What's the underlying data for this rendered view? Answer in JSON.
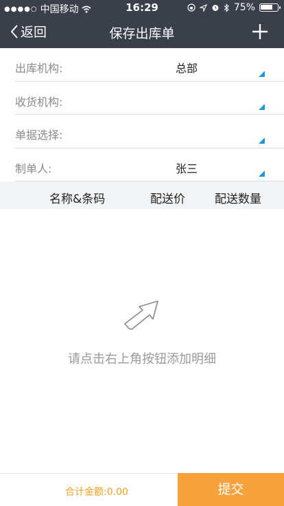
{
  "status_bar": {
    "carrier": "中国移动",
    "time": "16:29",
    "battery": "75%",
    "battery_level": 0.75
  },
  "nav": {
    "back_label": "返回",
    "title": "保存出库单",
    "add_icon": "plus-icon"
  },
  "form": {
    "rows": [
      {
        "label": "出库机构:",
        "value": "总部"
      },
      {
        "label": "收货机构:",
        "value": ""
      },
      {
        "label": "单据选择:",
        "value": ""
      },
      {
        "label": "制单人:",
        "value": "张三"
      }
    ]
  },
  "table": {
    "headers": [
      "名称&条码",
      "配送价",
      "配送数量"
    ]
  },
  "empty_state": {
    "text": "请点击右上角按钮添加明细",
    "icon": "arrow-up-right-icon"
  },
  "footer": {
    "total_label": "合计金额:0.00",
    "submit_label": "提交"
  },
  "colors": {
    "header_bg": "#3a3f4a",
    "accent_orange": "#f7a23c",
    "total_text": "#f3a01f",
    "dropdown_triangle": "#2196d6"
  }
}
